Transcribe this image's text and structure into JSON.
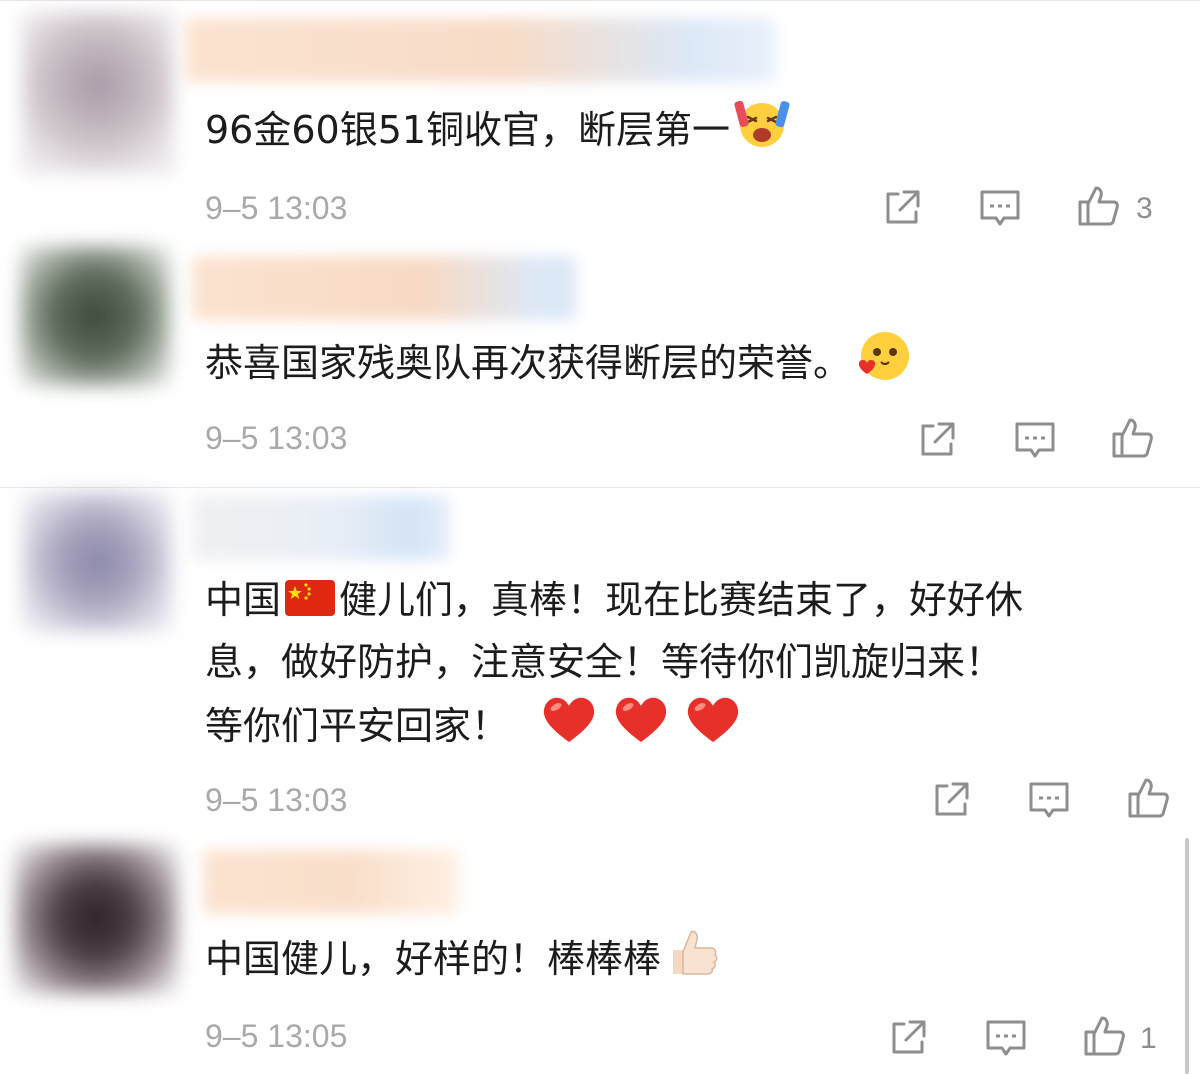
{
  "comments": [
    {
      "text": "96金60银51铜收官，断层第一",
      "emoji": "cheering-face-emoji",
      "time": "9–5 13:03",
      "like_count": "3"
    },
    {
      "text": "恭喜国家残奥队再次获得断层的荣誉。",
      "emoji": "blushing-heart-face-emoji",
      "time": "9–5 13:03",
      "like_count": ""
    },
    {
      "text_line1_part1": "中国",
      "text_line1_part2": "健儿们，真棒！现在比赛结束了，好好休",
      "text_line2": "息，做好防护，注意安全！等待你们凯旋归来！",
      "text_line3": "等你们平安回家！",
      "emoji_flag": "china-flag-emoji",
      "emoji_hearts": "red-heart-emoji",
      "time": "9–5 13:03",
      "like_count": ""
    },
    {
      "text": "中国健儿，好样的！棒棒棒",
      "emoji": "thumbs-up-emoji",
      "time": "9–5 13:05",
      "like_count": "1"
    }
  ],
  "icons": {
    "share": "share-icon",
    "comment": "comment-icon",
    "like": "thumbs-up-icon"
  },
  "colors": {
    "text": "#1c1c1c",
    "meta": "#a9a9a9",
    "icon": "#8e8e8e",
    "heart": "#e8302b",
    "flag": "#de2910"
  }
}
